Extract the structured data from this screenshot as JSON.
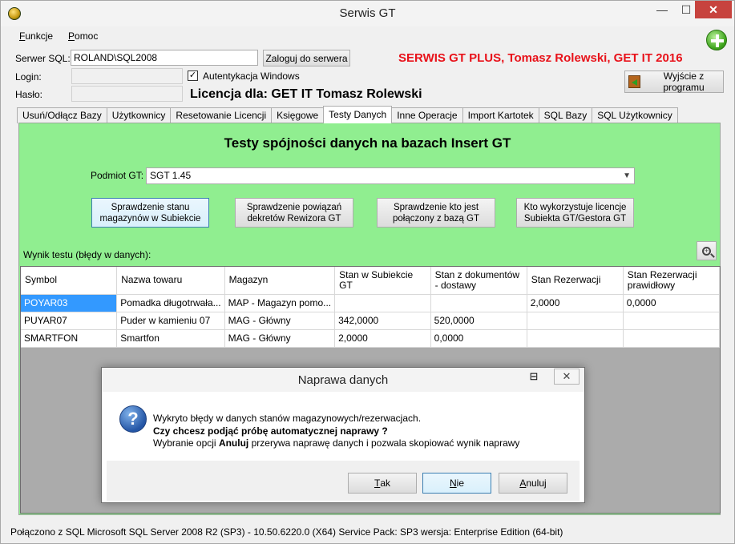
{
  "window": {
    "title": "Serwis GT",
    "min_glyph": "—",
    "max_glyph": "☐",
    "close_glyph": "✕"
  },
  "menu": [
    {
      "label": "Funkcje",
      "accel": "F",
      "rest": "unkcje"
    },
    {
      "label": "Pomoc",
      "accel": "P",
      "rest": "omoc"
    }
  ],
  "connection": {
    "server_label": "Serwer SQL:",
    "server_value": "ROLAND\\SQL2008",
    "login_button": "Zaloguj do serwera",
    "login_label": "Login:",
    "login_value": "",
    "password_label": "Hasło:",
    "password_value": "",
    "windows_auth_label": "Autentykacja Windows",
    "windows_auth_checked": "✓"
  },
  "brand_text": "SERWIS GT PLUS, Tomasz Rolewski, GET IT 2016",
  "licence_text": "Licencja dla: GET IT Tomasz Rolewski",
  "exit_button": "Wyjście z programu",
  "tabs": [
    {
      "label": "Usuń/Odłącz Bazy"
    },
    {
      "label": "Użytkownicy"
    },
    {
      "label": "Resetowanie Licencji"
    },
    {
      "label": "Księgowe"
    },
    {
      "label": "Testy Danych"
    },
    {
      "label": "Inne Operacje"
    },
    {
      "label": "Import Kartotek"
    },
    {
      "label": "SQL Bazy"
    },
    {
      "label": "SQL Użytkownicy"
    }
  ],
  "panel": {
    "title": "Testy spójności danych na bazach Insert GT",
    "subject_label": "Podmiot GT:",
    "subject_value": "SGT 1.45",
    "actions": [
      "Sprawdzenie stanu magazynów w Subiekcie",
      "Sprawdzenie powiązań dekretów Rewizora GT",
      "Sprawdzenie kto jest połączony z bazą GT",
      "Kto wykorzystuje licencje Subiekta GT/Gestora GT"
    ],
    "result_label": "Wynik testu (błędy w danych):"
  },
  "table": {
    "columns": [
      "Symbol",
      "Nazwa towaru",
      "Magazyn",
      "Stan w Subiekcie GT",
      "Stan z dokumentów - dostawy",
      "Stan Rezerwacji",
      "Stan Rezerwacji prawidłowy"
    ],
    "rows": [
      [
        "POYAR03",
        "Pomadka długotrwała...",
        "MAP - Magazyn pomo...",
        "",
        "",
        "2,0000",
        "0,0000"
      ],
      [
        "PUYAR07",
        "Puder w kamieniu 07",
        "MAG - Główny",
        "342,0000",
        "520,0000",
        "",
        ""
      ],
      [
        "SMARTFON",
        "Smartfon",
        "MAG - Główny",
        "2,0000",
        "0,0000",
        "",
        ""
      ]
    ]
  },
  "dialog": {
    "title": "Naprawa danych",
    "line1": "Wykryto błędy w danych stanów magazynowych/rezerwacjach.",
    "line2": "Czy chcesz podjąć próbę automatycznej naprawy ?",
    "line3_pre": "Wybranie opcji ",
    "line3_bold": "Anuluj",
    "line3_post": " przerywa naprawę danych i pozwala skopiować wynik naprawy",
    "buttons": [
      {
        "label": "Tak",
        "accel": "T",
        "rest": "ak"
      },
      {
        "label": "Nie",
        "accel": "N",
        "rest": "ie"
      },
      {
        "label": "Anuluj",
        "accel": "A",
        "rest": "nuluj"
      }
    ],
    "icon_glyph": "?",
    "restore_glyph": "⊟",
    "close_glyph": "✕"
  },
  "status_bar": "Połączono z SQL  Microsoft SQL Server 2008 R2 (SP3) - 10.50.6220.0 (X64)   Service Pack: SP3  wersja: Enterprise Edition (64-bit)"
}
